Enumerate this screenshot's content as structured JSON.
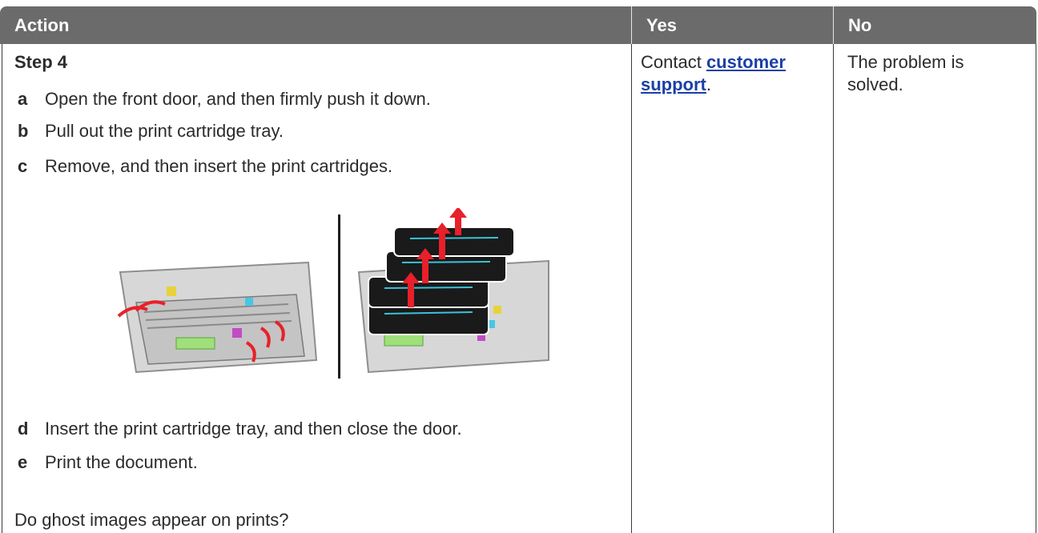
{
  "header": {
    "action": "Action",
    "yes": "Yes",
    "no": "No"
  },
  "step": {
    "title": "Step 4",
    "items": [
      {
        "letter": "a",
        "text": "Open the front door, and then firmly push it down."
      },
      {
        "letter": "b",
        "text": "Pull out the print cartridge tray."
      },
      {
        "letter": "c",
        "text": "Remove, and then insert the print cartridges."
      },
      {
        "letter": "d",
        "text": "Insert the print cartridge tray, and then close the door."
      },
      {
        "letter": "e",
        "text": "Print the document."
      }
    ],
    "question": "Do ghost images appear on prints?"
  },
  "yes": {
    "prefix": "Contact ",
    "link_line1": "customer",
    "link_line2": "support",
    "suffix": "."
  },
  "no": {
    "text": "The problem is solved."
  },
  "colors": {
    "header_bg": "#6b6b6b",
    "link": "#1b3fa6",
    "arrow": "#e8202a"
  }
}
